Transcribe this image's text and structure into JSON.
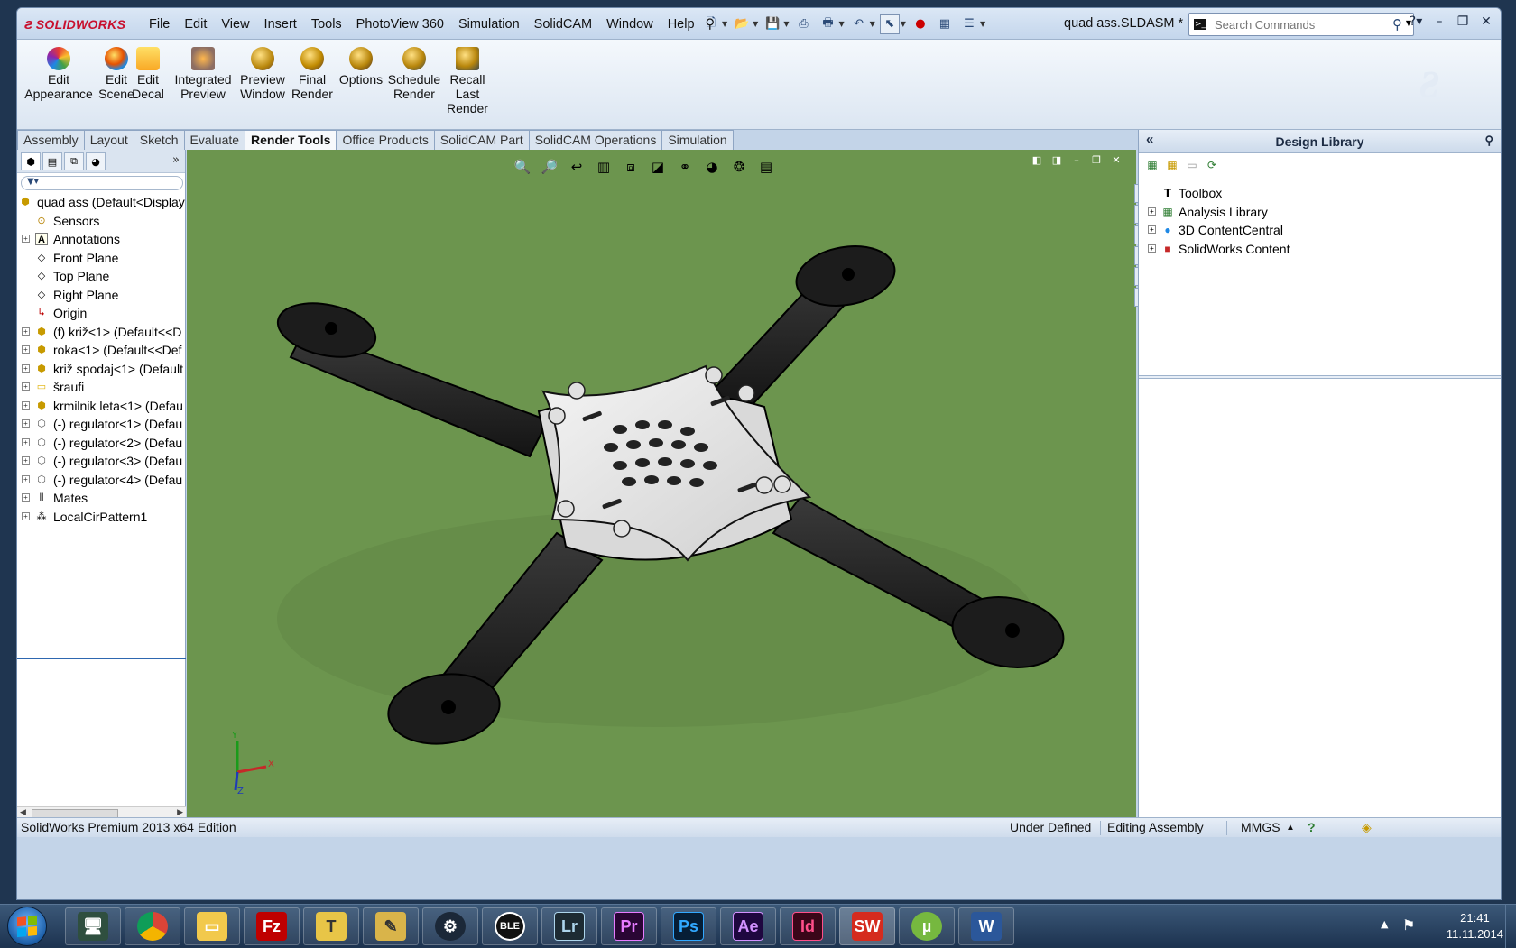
{
  "app": {
    "logo_text": "SOLIDWORKS",
    "document_title": "quad ass.SLDASM *",
    "menu": [
      "File",
      "Edit",
      "View",
      "Insert",
      "Tools",
      "PhotoView 360",
      "Simulation",
      "SolidCAM",
      "Window",
      "Help"
    ],
    "search_placeholder": "Search Commands"
  },
  "commands": [
    {
      "label": "Edit\nAppearance",
      "icon": "appearance-icon"
    },
    {
      "label": "Edit\nScene",
      "icon": "scene-icon"
    },
    {
      "label": "Edit\nDecal",
      "icon": "decal-icon"
    },
    {
      "label": "Integrated\nPreview",
      "icon": "integrated-preview-icon"
    },
    {
      "label": "Preview\nWindow",
      "icon": "preview-window-icon"
    },
    {
      "label": "Final\nRender",
      "icon": "final-render-icon"
    },
    {
      "label": "Options",
      "icon": "options-icon"
    },
    {
      "label": "Schedule\nRender",
      "icon": "schedule-render-icon"
    },
    {
      "label": "Recall\nLast\nRender",
      "icon": "recall-render-icon"
    }
  ],
  "tabs": [
    "Assembly",
    "Layout",
    "Sketch",
    "Evaluate",
    "Render Tools",
    "Office Products",
    "SolidCAM Part",
    "SolidCAM Operations",
    "Simulation"
  ],
  "active_tab": "Render Tools",
  "feature_tree": {
    "root": "quad ass  (Default<Display",
    "items": [
      {
        "label": "Sensors",
        "expandable": false,
        "icon": "sensors-icon"
      },
      {
        "label": "Annotations",
        "expandable": true,
        "icon": "annotations-icon"
      },
      {
        "label": "Front Plane",
        "expandable": false,
        "icon": "plane-icon"
      },
      {
        "label": "Top Plane",
        "expandable": false,
        "icon": "plane-icon"
      },
      {
        "label": "Right Plane",
        "expandable": false,
        "icon": "plane-icon"
      },
      {
        "label": "Origin",
        "expandable": false,
        "icon": "origin-icon"
      },
      {
        "label": "(f) križ<1> (Default<<D",
        "expandable": true,
        "icon": "part-icon"
      },
      {
        "label": "roka<1> (Default<<Def",
        "expandable": true,
        "icon": "part-icon"
      },
      {
        "label": "križ spodaj<1> (Default",
        "expandable": true,
        "icon": "part-icon"
      },
      {
        "label": "šraufi",
        "expandable": true,
        "icon": "folder-icon"
      },
      {
        "label": "krmilnik leta<1> (Defau",
        "expandable": true,
        "icon": "part-icon"
      },
      {
        "label": "(-) regulator<1> (Defau",
        "expandable": true,
        "icon": "part-outline-icon"
      },
      {
        "label": "(-) regulator<2> (Defau",
        "expandable": true,
        "icon": "part-outline-icon"
      },
      {
        "label": "(-) regulator<3> (Defau",
        "expandable": true,
        "icon": "part-outline-icon"
      },
      {
        "label": "(-) regulator<4> (Defau",
        "expandable": true,
        "icon": "part-outline-icon"
      },
      {
        "label": "Mates",
        "expandable": true,
        "icon": "mates-icon"
      },
      {
        "label": "LocalCirPattern1",
        "expandable": true,
        "icon": "pattern-icon"
      }
    ]
  },
  "design_library": {
    "title": "Design Library",
    "items": [
      {
        "label": "Toolbox",
        "expandable": false,
        "icon": "toolbox-icon"
      },
      {
        "label": "Analysis Library",
        "expandable": true,
        "icon": "library-icon"
      },
      {
        "label": "3D ContentCentral",
        "expandable": true,
        "icon": "globe-icon"
      },
      {
        "label": "SolidWorks Content",
        "expandable": true,
        "icon": "sw-content-icon"
      }
    ]
  },
  "status": {
    "edition": "SolidWorks Premium 2013 x64 Edition",
    "definition": "Under Defined",
    "mode": "Editing Assembly",
    "units": "MMGS"
  },
  "taskbar": {
    "apps": [
      "windows-explorer",
      "chrome",
      "file-manager",
      "filezilla",
      "text-editor",
      "notes",
      "steam",
      "ble",
      "Lr",
      "Pr",
      "Ps",
      "Ae",
      "Id",
      "SW",
      "utorrent",
      "W"
    ],
    "time": "21:41",
    "date": "11.11.2014"
  },
  "viewport": {
    "background_color": "#6c954e",
    "triad": {
      "x": "X",
      "y": "Y",
      "z": "Z"
    }
  }
}
